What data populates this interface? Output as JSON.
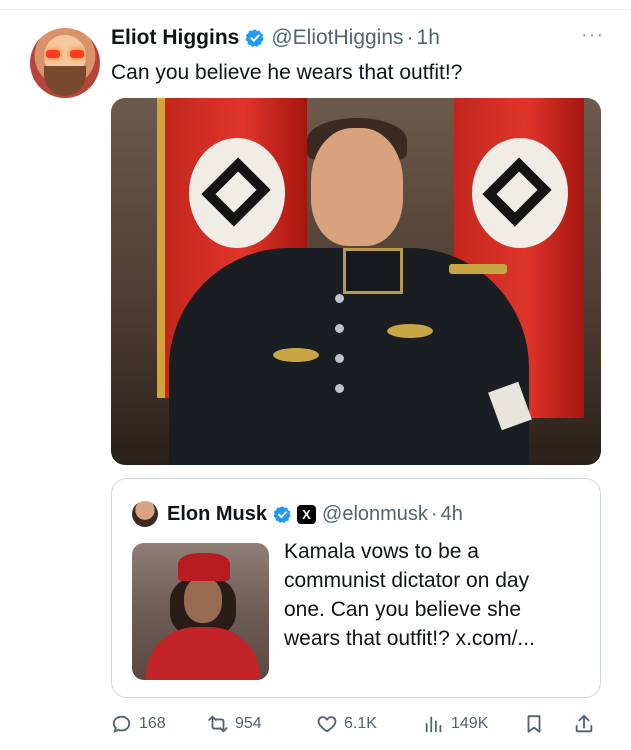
{
  "tweet": {
    "author_name": "Eliot Higgins",
    "author_handle": "@EliotHiggins",
    "separator": "·",
    "time": "1h",
    "text": "Can you believe he wears that outfit!?",
    "more_label": "···"
  },
  "quoted": {
    "author_name": "Elon Musk",
    "author_handle": "@elonmusk",
    "separator": "·",
    "time": "4h",
    "badge_label": "X",
    "text_lines": [
      "Kamala vows to be a",
      "communist dictator on day",
      "one. Can you believe she",
      "wears that outfit!? x.com/..."
    ]
  },
  "actions": {
    "replies": "168",
    "reposts": "954",
    "likes": "6.1K",
    "views": "149K"
  },
  "colors": {
    "verified": "#1d9bf0",
    "muted_text": "#536471",
    "border": "#cfd9de"
  }
}
